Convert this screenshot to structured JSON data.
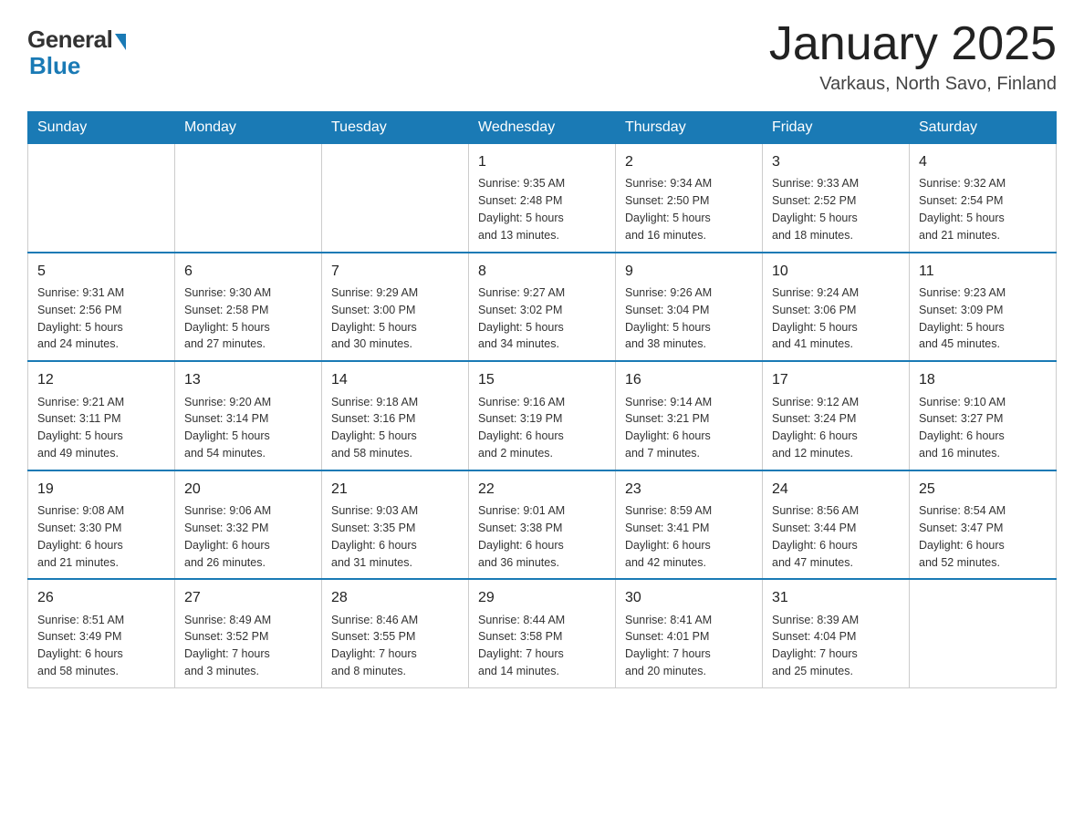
{
  "header": {
    "logo_general": "General",
    "logo_blue": "Blue",
    "month_title": "January 2025",
    "subtitle": "Varkaus, North Savo, Finland"
  },
  "days_of_week": [
    "Sunday",
    "Monday",
    "Tuesday",
    "Wednesday",
    "Thursday",
    "Friday",
    "Saturday"
  ],
  "weeks": [
    [
      {
        "day": "",
        "info": ""
      },
      {
        "day": "",
        "info": ""
      },
      {
        "day": "",
        "info": ""
      },
      {
        "day": "1",
        "info": "Sunrise: 9:35 AM\nSunset: 2:48 PM\nDaylight: 5 hours\nand 13 minutes."
      },
      {
        "day": "2",
        "info": "Sunrise: 9:34 AM\nSunset: 2:50 PM\nDaylight: 5 hours\nand 16 minutes."
      },
      {
        "day": "3",
        "info": "Sunrise: 9:33 AM\nSunset: 2:52 PM\nDaylight: 5 hours\nand 18 minutes."
      },
      {
        "day": "4",
        "info": "Sunrise: 9:32 AM\nSunset: 2:54 PM\nDaylight: 5 hours\nand 21 minutes."
      }
    ],
    [
      {
        "day": "5",
        "info": "Sunrise: 9:31 AM\nSunset: 2:56 PM\nDaylight: 5 hours\nand 24 minutes."
      },
      {
        "day": "6",
        "info": "Sunrise: 9:30 AM\nSunset: 2:58 PM\nDaylight: 5 hours\nand 27 minutes."
      },
      {
        "day": "7",
        "info": "Sunrise: 9:29 AM\nSunset: 3:00 PM\nDaylight: 5 hours\nand 30 minutes."
      },
      {
        "day": "8",
        "info": "Sunrise: 9:27 AM\nSunset: 3:02 PM\nDaylight: 5 hours\nand 34 minutes."
      },
      {
        "day": "9",
        "info": "Sunrise: 9:26 AM\nSunset: 3:04 PM\nDaylight: 5 hours\nand 38 minutes."
      },
      {
        "day": "10",
        "info": "Sunrise: 9:24 AM\nSunset: 3:06 PM\nDaylight: 5 hours\nand 41 minutes."
      },
      {
        "day": "11",
        "info": "Sunrise: 9:23 AM\nSunset: 3:09 PM\nDaylight: 5 hours\nand 45 minutes."
      }
    ],
    [
      {
        "day": "12",
        "info": "Sunrise: 9:21 AM\nSunset: 3:11 PM\nDaylight: 5 hours\nand 49 minutes."
      },
      {
        "day": "13",
        "info": "Sunrise: 9:20 AM\nSunset: 3:14 PM\nDaylight: 5 hours\nand 54 minutes."
      },
      {
        "day": "14",
        "info": "Sunrise: 9:18 AM\nSunset: 3:16 PM\nDaylight: 5 hours\nand 58 minutes."
      },
      {
        "day": "15",
        "info": "Sunrise: 9:16 AM\nSunset: 3:19 PM\nDaylight: 6 hours\nand 2 minutes."
      },
      {
        "day": "16",
        "info": "Sunrise: 9:14 AM\nSunset: 3:21 PM\nDaylight: 6 hours\nand 7 minutes."
      },
      {
        "day": "17",
        "info": "Sunrise: 9:12 AM\nSunset: 3:24 PM\nDaylight: 6 hours\nand 12 minutes."
      },
      {
        "day": "18",
        "info": "Sunrise: 9:10 AM\nSunset: 3:27 PM\nDaylight: 6 hours\nand 16 minutes."
      }
    ],
    [
      {
        "day": "19",
        "info": "Sunrise: 9:08 AM\nSunset: 3:30 PM\nDaylight: 6 hours\nand 21 minutes."
      },
      {
        "day": "20",
        "info": "Sunrise: 9:06 AM\nSunset: 3:32 PM\nDaylight: 6 hours\nand 26 minutes."
      },
      {
        "day": "21",
        "info": "Sunrise: 9:03 AM\nSunset: 3:35 PM\nDaylight: 6 hours\nand 31 minutes."
      },
      {
        "day": "22",
        "info": "Sunrise: 9:01 AM\nSunset: 3:38 PM\nDaylight: 6 hours\nand 36 minutes."
      },
      {
        "day": "23",
        "info": "Sunrise: 8:59 AM\nSunset: 3:41 PM\nDaylight: 6 hours\nand 42 minutes."
      },
      {
        "day": "24",
        "info": "Sunrise: 8:56 AM\nSunset: 3:44 PM\nDaylight: 6 hours\nand 47 minutes."
      },
      {
        "day": "25",
        "info": "Sunrise: 8:54 AM\nSunset: 3:47 PM\nDaylight: 6 hours\nand 52 minutes."
      }
    ],
    [
      {
        "day": "26",
        "info": "Sunrise: 8:51 AM\nSunset: 3:49 PM\nDaylight: 6 hours\nand 58 minutes."
      },
      {
        "day": "27",
        "info": "Sunrise: 8:49 AM\nSunset: 3:52 PM\nDaylight: 7 hours\nand 3 minutes."
      },
      {
        "day": "28",
        "info": "Sunrise: 8:46 AM\nSunset: 3:55 PM\nDaylight: 7 hours\nand 8 minutes."
      },
      {
        "day": "29",
        "info": "Sunrise: 8:44 AM\nSunset: 3:58 PM\nDaylight: 7 hours\nand 14 minutes."
      },
      {
        "day": "30",
        "info": "Sunrise: 8:41 AM\nSunset: 4:01 PM\nDaylight: 7 hours\nand 20 minutes."
      },
      {
        "day": "31",
        "info": "Sunrise: 8:39 AM\nSunset: 4:04 PM\nDaylight: 7 hours\nand 25 minutes."
      },
      {
        "day": "",
        "info": ""
      }
    ]
  ]
}
